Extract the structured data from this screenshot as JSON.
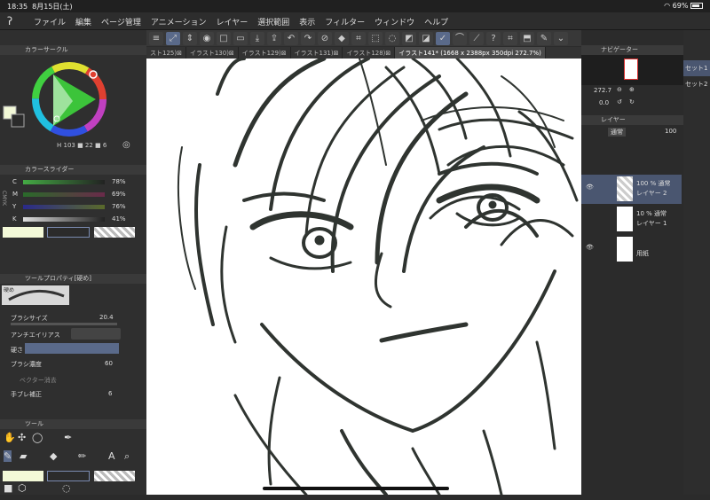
{
  "status": {
    "time": "18:35",
    "date": "8月15日(土)",
    "battery": "69%"
  },
  "menu": [
    "ファイル",
    "編集",
    "ページ管理",
    "アニメーション",
    "レイヤー",
    "選択範囲",
    "表示",
    "フィルター",
    "ウィンドウ",
    "ヘルプ"
  ],
  "tabs": [
    "スト125)⊠",
    "イラスト130)⊠",
    "イラスト129)⊠",
    "イラスト131)⊠",
    "イラスト128)⊠",
    "イラスト141* (1668 x 2388px 350dpi 272.7%)"
  ],
  "color_circle": {
    "title": "カラーサークル",
    "hsv": "H 103 ■ 22 ■ 6"
  },
  "color_slider": {
    "title": "カラースライダー",
    "c": "78%",
    "m": "69%",
    "y": "76%",
    "k": "41%",
    "mode": "CMYK"
  },
  "tool_property": {
    "title": "ツールプロパティ[硬め]",
    "brush_name": "硬め",
    "brush_size_label": "ブラシサイズ",
    "brush_size": "20.4",
    "antialias_label": "アンチエイリアス",
    "hardness_label": "硬さ",
    "density_label": "ブラシ濃度",
    "density": "60",
    "vector_erase_label": "ベクター消去",
    "stabilization_label": "手ブレ補正",
    "stabilization": "6"
  },
  "tool_panel": {
    "title": "ツール"
  },
  "navigator": {
    "title": "ナビゲーター",
    "zoom": "272.7",
    "angle": "0.0"
  },
  "layer_panel": {
    "title": "レイヤー",
    "blend": "通常",
    "opacity": "100"
  },
  "layers": [
    {
      "line1": "100 % 通常",
      "line2": "レイヤー 2",
      "selected": true
    },
    {
      "line1": "10 % 通常",
      "line2": "レイヤー 1",
      "selected": false
    },
    {
      "line1": "",
      "line2": "用紙",
      "selected": false
    }
  ],
  "right_tabs": [
    "セット1",
    "セット2"
  ],
  "colors": {
    "accent": "#5a6a8a",
    "fg": "#f3f9d8",
    "bg": "#ffffff",
    "ink": "#2f3430"
  }
}
